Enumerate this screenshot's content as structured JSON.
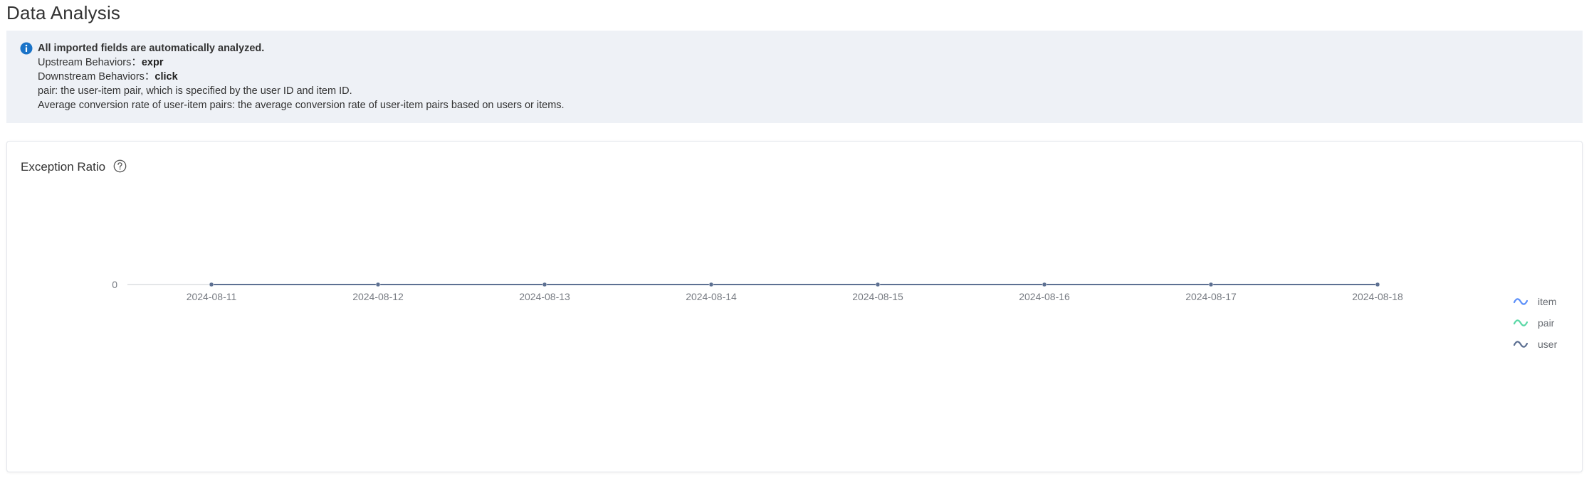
{
  "page": {
    "title": "Data Analysis"
  },
  "info": {
    "headline": "All imported fields are automatically analyzed.",
    "upstream_label": "Upstream Behaviors：",
    "upstream_value": "expr",
    "downstream_label": "Downstream Behaviors：",
    "downstream_value": "click",
    "pair_note": "pair: the user-item pair, which is specified by the user ID and item ID.",
    "avg_note": "Average conversion rate of user-item pairs: the average conversion rate of user-item pairs based on users or items.",
    "icon": "info-circle-icon",
    "icon_color": "#1a73c8"
  },
  "card": {
    "title": "Exception Ratio",
    "help_icon": "question-circle-icon"
  },
  "chart_data": {
    "type": "line",
    "title": "Exception Ratio",
    "x": [
      "2024-08-11",
      "2024-08-12",
      "2024-08-13",
      "2024-08-14",
      "2024-08-15",
      "2024-08-16",
      "2024-08-17",
      "2024-08-18"
    ],
    "y_ticks": [
      "0"
    ],
    "ylim": [
      0,
      1
    ],
    "grid": false,
    "legend_position": "right",
    "series": [
      {
        "name": "item",
        "color": "#5b8ff9",
        "values": [
          0,
          0,
          0,
          0,
          0,
          0,
          0,
          0
        ]
      },
      {
        "name": "pair",
        "color": "#5ad8a6",
        "values": [
          0,
          0,
          0,
          0,
          0,
          0,
          0,
          0
        ]
      },
      {
        "name": "user",
        "color": "#5d7092",
        "values": [
          0,
          0,
          0,
          0,
          0,
          0,
          0,
          0
        ]
      }
    ]
  }
}
